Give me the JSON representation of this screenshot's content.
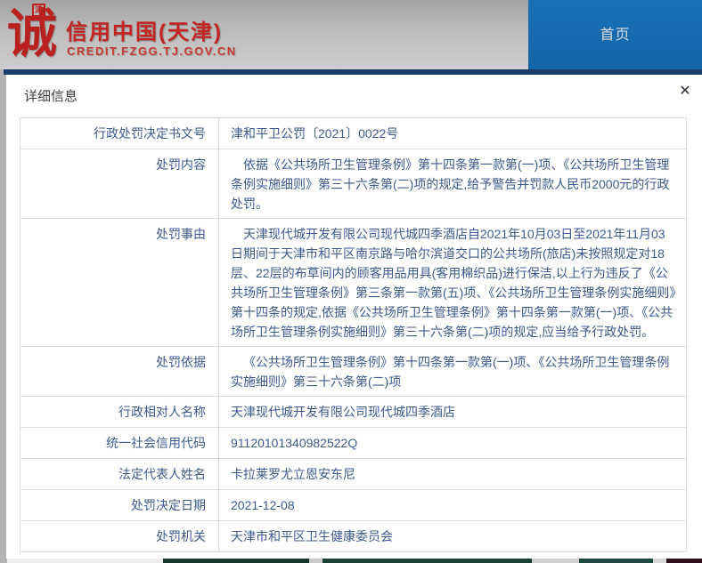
{
  "header": {
    "logo_char": "诚",
    "logo_seal_char": "津",
    "site_title": "信用中国(天津)",
    "site_url": "CREDIT.FZGG.TJ.GOV.CN",
    "nav_home_label": "首页",
    "colors": {
      "brand_red": "#c32322",
      "nav_blue": "#1568ac",
      "divider_navy": "#1d3c6e",
      "table_text_navy": "#3c5a8e"
    }
  },
  "modal": {
    "title": "详细信息",
    "close_icon": "✕",
    "table": {
      "rows": [
        {
          "label": "行政处罚决定书文号",
          "value": "津和平卫公罚〔2021〕0022号"
        },
        {
          "label": "处罚内容",
          "value": "依据《公共场所卫生管理条例》第十四条第一款第(一)项、《公共场所卫生管理条例实施细则》第三十六条第(二)项的规定,给予警告并罚款人民币2000元的行政处罚。"
        },
        {
          "label": "处罚事由",
          "value": "天津现代城开发有限公司现代城四季酒店自2021年10月03日至2021年11月03日期间于天津市和平区南京路与哈尔滨道交口的公共场所(旅店)未按照规定对18层、22层的布草间内的顾客用品用具(客用棉织品)进行保洁,以上行为违反了《公共场所卫生管理条例》第三条第一款第(五)项、《公共场所卫生管理条例实施细则》第十四条的规定,依据《公共场所卫生管理条例》第十四条第一款第(一)项、《公共场所卫生管理条例实施细则》第三十六条第(二)项的规定,应当给予行政处罚。"
        },
        {
          "label": "处罚依据",
          "value": "《公共场所卫生管理条例》第十四条第一款第(一)项、《公共场所卫生管理条例实施细则》第三十六条第(二)项"
        },
        {
          "label": "行政相对人名称",
          "value": "天津现代城开发有限公司现代城四季酒店"
        },
        {
          "label": "统一社会信用代码",
          "value": "91120101340982522Q"
        },
        {
          "label": "法定代表人姓名",
          "value": "卡拉莱罗尤立恩安东尼"
        },
        {
          "label": "处罚决定日期",
          "value": "2021-12-08"
        },
        {
          "label": "处罚机关",
          "value": "天津市和平区卫生健康委员会"
        }
      ]
    }
  }
}
